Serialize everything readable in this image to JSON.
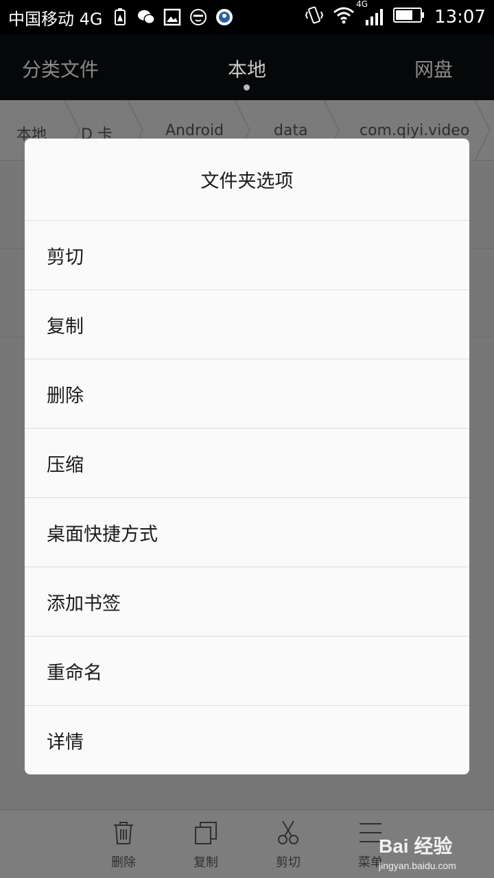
{
  "status_bar": {
    "carrier": "中国移动 4G",
    "network_badge": "4G",
    "time": "13:07",
    "icons": [
      "battery-warning-icon",
      "wechat-icon",
      "image-icon",
      "emoji-icon",
      "security-icon",
      "vibrate-icon",
      "wifi-icon",
      "signal-icon",
      "battery-icon"
    ]
  },
  "tabs": [
    {
      "label": "分类文件",
      "active": false
    },
    {
      "label": "本地",
      "active": true
    },
    {
      "label": "网盘",
      "active": false
    }
  ],
  "breadcrumb": [
    "本地",
    "D 卡",
    "Android",
    "data",
    "com.qiyi.video"
  ],
  "dialog": {
    "title": "文件夹选项",
    "items": [
      "剪切",
      "复制",
      "删除",
      "压缩",
      "桌面快捷方式",
      "添加书签",
      "重命名",
      "详情"
    ]
  },
  "bottom_bar": {
    "items": [
      {
        "label": "删除",
        "icon": "trash-icon"
      },
      {
        "label": "复制",
        "icon": "copy-icon"
      },
      {
        "label": "剪切",
        "icon": "scissors-icon"
      },
      {
        "label": "菜单",
        "icon": "menu-icon"
      }
    ]
  },
  "watermark": {
    "logo": "Bai 经验",
    "url": "jingyan.baidu.com"
  }
}
